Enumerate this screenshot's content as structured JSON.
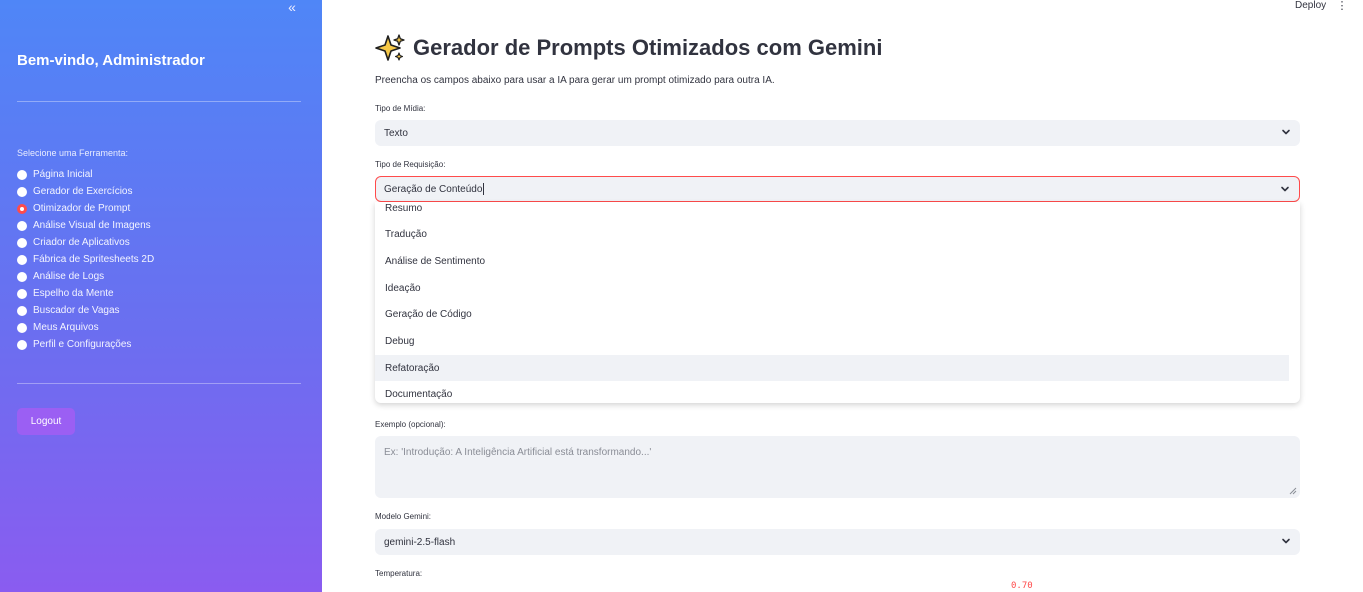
{
  "sidebar": {
    "collapse_icon": "«",
    "welcome": "Bem-vindo, Administrador",
    "nav_label": "Selecione uma Ferramenta:",
    "items": [
      {
        "label": "Página Inicial",
        "selected": false
      },
      {
        "label": "Gerador de Exercícios",
        "selected": false
      },
      {
        "label": "Otimizador de Prompt",
        "selected": true
      },
      {
        "label": "Análise Visual de Imagens",
        "selected": false
      },
      {
        "label": "Criador de Aplicativos",
        "selected": false
      },
      {
        "label": "Fábrica de Spritesheets 2D",
        "selected": false
      },
      {
        "label": "Análise de Logs",
        "selected": false
      },
      {
        "label": "Espelho da Mente",
        "selected": false
      },
      {
        "label": "Buscador de Vagas",
        "selected": false
      },
      {
        "label": "Meus Arquivos",
        "selected": false
      },
      {
        "label": "Perfil e Configurações",
        "selected": false
      }
    ],
    "logout_label": "Logout"
  },
  "toolbar": {
    "deploy_label": "Deploy",
    "menu_icon": "⋮"
  },
  "main": {
    "title": "Gerador de Prompts Otimizados com Gemini",
    "title_icon": "sparkles-icon",
    "subtitle": "Preencha os campos abaixo para usar a IA para gerar um prompt otimizado para outra IA.",
    "media_type": {
      "label": "Tipo de Mídia:",
      "value": "Texto"
    },
    "request_type": {
      "label": "Tipo de Requisição:",
      "value": "Geração de Conteúdo",
      "options": [
        "Resumo",
        "Tradução",
        "Análise de Sentimento",
        "Ideação",
        "Geração de Código",
        "Debug",
        "Refatoração",
        "Documentação"
      ],
      "hovered_option": "Refatoração"
    },
    "example": {
      "label": "Exemplo (opcional):",
      "placeholder": "Ex: 'Introdução: A Inteligência Artificial está transformando...'"
    },
    "model": {
      "label": "Modelo Gemini:",
      "value": "gemini-2.5-flash"
    },
    "temperature": {
      "label": "Temperatura:",
      "value": "0.70"
    }
  },
  "colors": {
    "accent": "#ff4b4b",
    "sidebar_top": "#4f86f7",
    "sidebar_bottom": "#8a5cf0",
    "logout_button": "#9b5ff3",
    "field_bg": "#f0f2f6"
  }
}
